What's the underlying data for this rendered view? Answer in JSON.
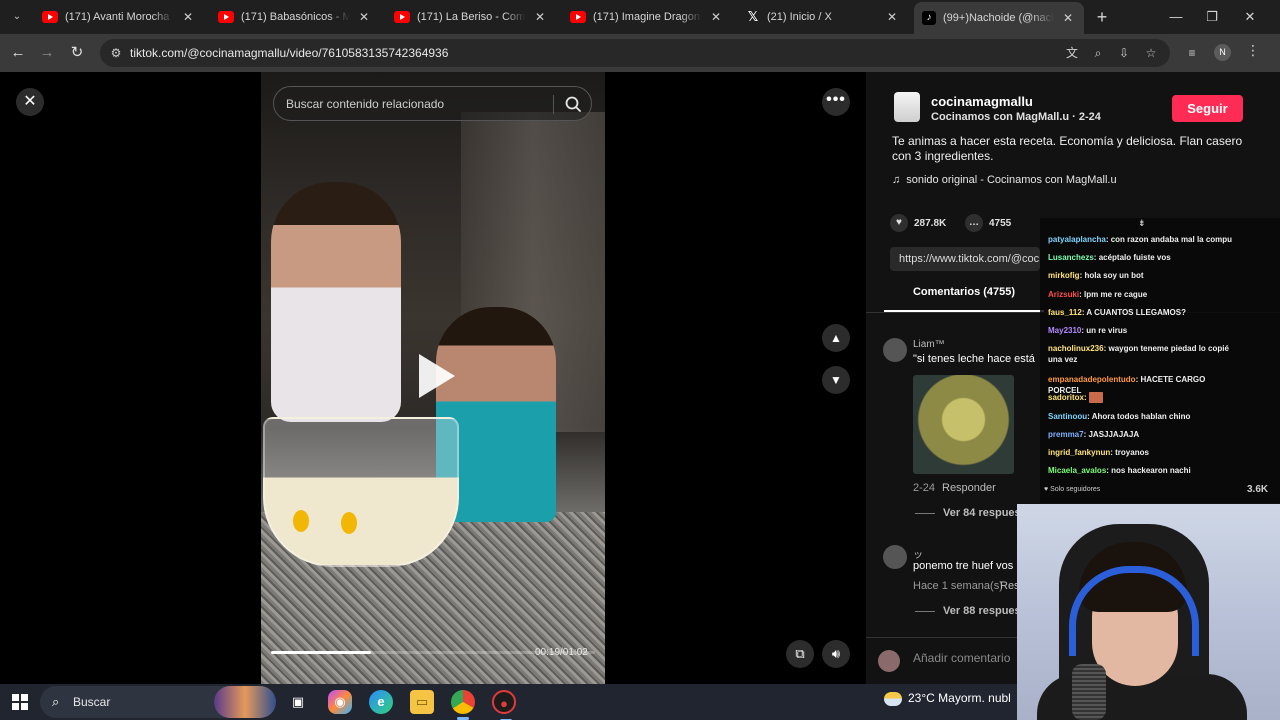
{
  "browser": {
    "tabs": [
      {
        "title": "(171) Avanti Morocha (CAI",
        "icon": "youtube-icon"
      },
      {
        "title": "(171) Babasónicos - Microc",
        "icon": "youtube-icon"
      },
      {
        "title": "(171) La Beriso - Como Olv",
        "icon": "youtube-icon"
      },
      {
        "title": "(171) Imagine Dragons - R",
        "icon": "youtube-icon"
      },
      {
        "title": "(21) Inicio / X",
        "icon": "x-icon"
      },
      {
        "title": "(99+)Nachoide (@nachoid",
        "icon": "tiktok-icon",
        "active": true
      }
    ],
    "url": "tiktok.com/@cocinamagmallu/video/7610583135742364936",
    "profile_initial": "N"
  },
  "player": {
    "search_placeholder": "Buscar contenido relacionado",
    "time": "00:19/01:02",
    "progress": 0.31
  },
  "post": {
    "author": "cocinamagmallu",
    "author_sub": "Cocinamos con MagMall.u · 2-24",
    "follow_label": "Seguir",
    "description": "Te animas a hacer esta receta. Economía y deliciosa. Flan casero con 3 ingredientes.",
    "music": "sonido original - Cocinamos con MagMall.u",
    "likes": "287.8K",
    "comments_count": "4755",
    "link": "https://www.tiktok.com/@coc",
    "comments_tab": "Comentarios (4755)"
  },
  "comments": [
    {
      "user": "Liam™",
      "text": "\"si tenes leche hace está",
      "date": "2-24",
      "reply": "Responder",
      "more": "Ver 84 respues"
    },
    {
      "user": "ッ",
      "text": "ponemo tre huef vos",
      "date": "Hace 1 semana(s)",
      "reply": "Res",
      "more": "Ver 88 respues"
    }
  ],
  "add_comment_placeholder": "Añadir comentario",
  "chat": {
    "messages": [
      {
        "user": "patyalaplancha",
        "color": "#7fd4ff",
        "text": "con razon andaba mal la compu"
      },
      {
        "user": "Lusanchezs",
        "color": "#7dffb0",
        "text": "acéptalo fuiste vos"
      },
      {
        "user": "mirkofig",
        "color": "#ffe47a",
        "text": "hola soy un bot"
      },
      {
        "user": "Arizsuki",
        "color": "#ff4d4d",
        "text": "lpm me re cague"
      },
      {
        "user": "faus_112",
        "color": "#ffe47a",
        "text": "A CUANTOS LLEGAMOS?"
      },
      {
        "user": "May2310",
        "color": "#b48cff",
        "text": "un re virus"
      },
      {
        "user": "nacholinux236",
        "color": "#ffe47a",
        "text": "waygon teneme piedad lo copié una vez"
      },
      {
        "user": "empanadadepolentudo",
        "color": "#ff9a3c",
        "text": "HACETE CARGO PORCEL"
      },
      {
        "user": "sadoritox",
        "color": "#ffe47a",
        "text": ""
      },
      {
        "user": "Santinoou",
        "color": "#7fd4ff",
        "text": "Ahora todos hablan chino"
      },
      {
        "user": "premma7",
        "color": "#7fb0ff",
        "text": "JASJJAJAJA"
      },
      {
        "user": "ingrid_fankynun",
        "color": "#ffe47a",
        "text": "troyanos"
      },
      {
        "user": "Micaela_avalos",
        "color": "#7dff7d",
        "text": "nos hackearon nachi"
      }
    ],
    "footer": "Solo seguidores",
    "count_suffix": "3.6K"
  },
  "taskbar": {
    "search_label": "Buscar",
    "weather": "23°C  Mayorm. nubl"
  }
}
